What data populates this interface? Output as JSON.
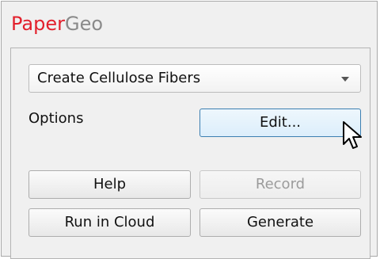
{
  "app": {
    "brand_part1": "Paper",
    "brand_part2": "Geo",
    "colors": {
      "brand_red": "#e2202c",
      "brand_gray": "#8a8a8a",
      "hover_border": "#3c7fb1"
    }
  },
  "panel": {
    "dropdown": {
      "selected": "Create Cellulose Fibers",
      "icon": "chevron-down-icon"
    },
    "options_label": "Options",
    "buttons": {
      "edit": "Edit...",
      "help": "Help",
      "record": "Record",
      "run_in_cloud": "Run in Cloud",
      "generate": "Generate"
    }
  },
  "cursor": {
    "icon": "mouse-pointer-icon"
  }
}
